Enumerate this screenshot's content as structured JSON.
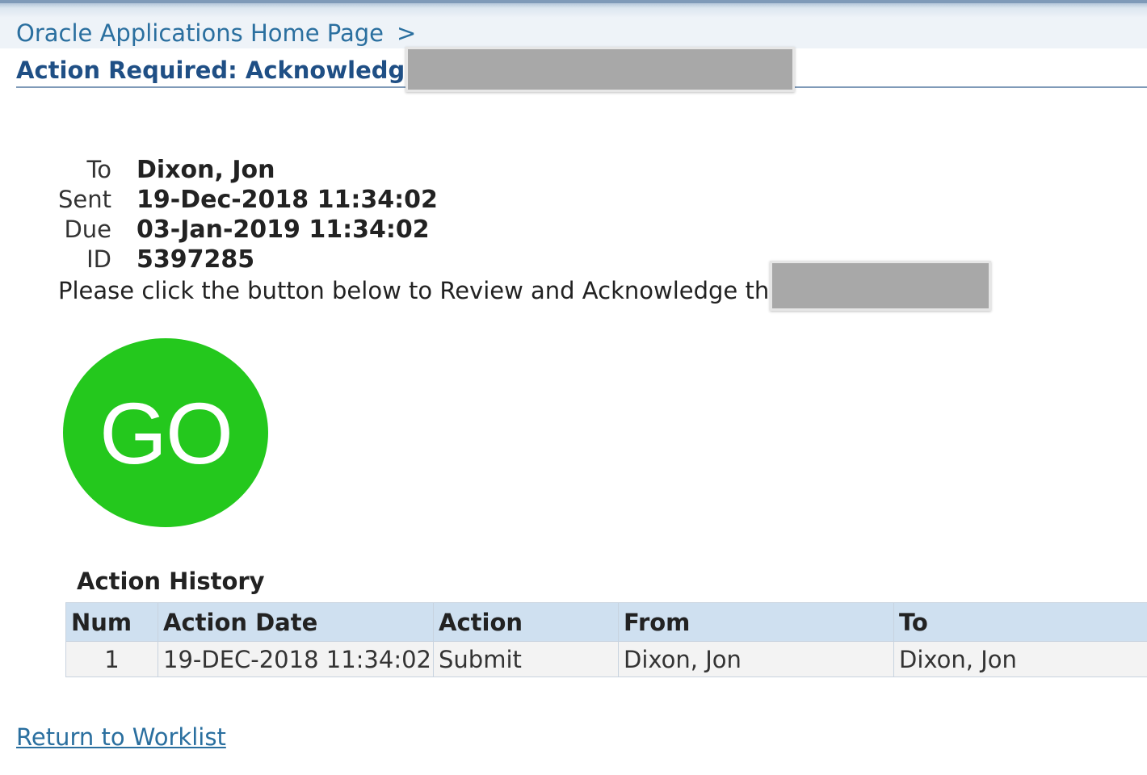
{
  "header": {
    "breadcrumb_label": "Oracle Applications Home Page",
    "breadcrumb_separator": ">",
    "page_title": "Action Required: Acknowledge"
  },
  "notification": {
    "to_label": "To",
    "to_value": "Dixon, Jon",
    "sent_label": "Sent",
    "sent_value": "19-Dec-2018 11:34:02",
    "due_label": "Due",
    "due_value": "03-Jan-2019 11:34:02",
    "id_label": "ID",
    "id_value": "5397285",
    "instruction": "Please click the button below to Review and Acknowledge the"
  },
  "go_button": {
    "label": "GO",
    "color": "#24c81d"
  },
  "action_history": {
    "title": "Action History",
    "columns": [
      "Num",
      "Action Date",
      "Action",
      "From",
      "To"
    ],
    "rows": [
      [
        "1",
        "19-DEC-2018 11:34:02",
        "Submit",
        "Dixon, Jon",
        "Dixon, Jon"
      ]
    ]
  },
  "footer": {
    "return_link": "Return to Worklist"
  },
  "colors": {
    "link": "#2a6f9f",
    "title": "#1f4f85",
    "table_header": "#cfe0f0"
  }
}
